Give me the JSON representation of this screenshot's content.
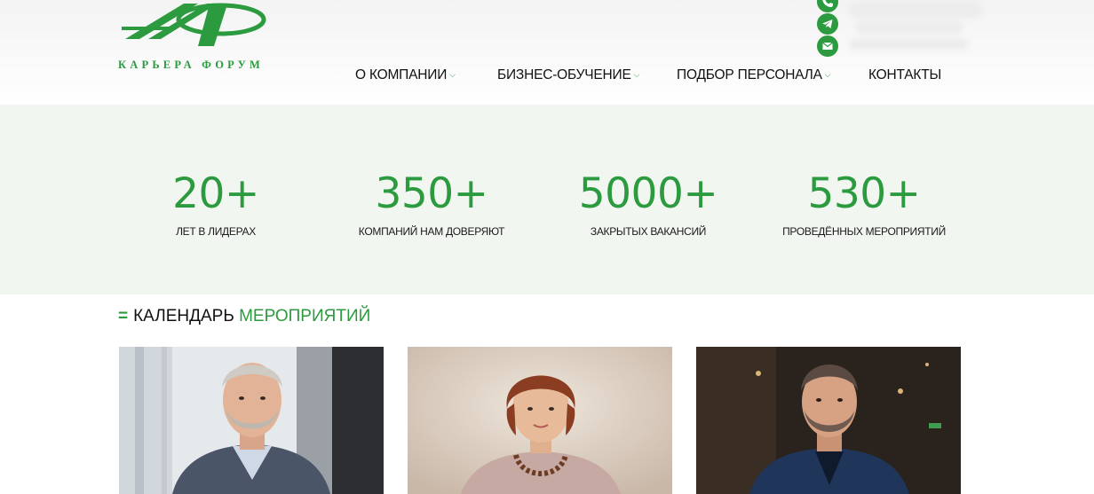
{
  "header": {
    "logo_text": "КАРЬЕРА ФОРУМ",
    "nav": [
      {
        "label": "О КОМПАНИИ",
        "has_dropdown": true
      },
      {
        "label": "БИЗНЕС-ОБУЧЕНИЕ",
        "has_dropdown": true
      },
      {
        "label": "ПОДБОР ПЕРСОНАЛА",
        "has_dropdown": true
      },
      {
        "label": "КОНТАКТЫ",
        "has_dropdown": false
      }
    ],
    "contact_icons": [
      "phone-icon",
      "telegram-icon",
      "email-icon"
    ]
  },
  "stats": [
    {
      "value": "20+",
      "label": "ЛЕТ В ЛИДЕРАХ"
    },
    {
      "value": "350+",
      "label": "КОМПАНИЙ НАМ ДОВЕРЯЮТ"
    },
    {
      "value": "5000+",
      "label": "ЗАКРЫТЫХ ВАКАНСИЙ"
    },
    {
      "value": "530+",
      "label": "ПРОВЕДЁННЫХ МЕРОПРИЯТИЙ"
    }
  ],
  "calendar": {
    "title_prefix": "=",
    "title_dark": "КАЛЕНДАРЬ",
    "title_green": "МЕРОПРИЯТИЙ"
  },
  "colors": {
    "accent": "#2c9a3e",
    "stats_bg": "#f1f6f1"
  }
}
